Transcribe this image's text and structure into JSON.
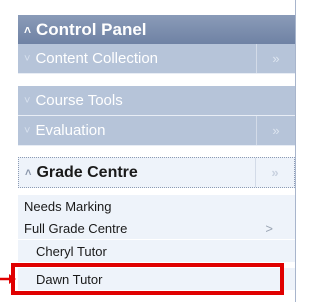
{
  "panel": {
    "title": "Control Panel",
    "sections": [
      {
        "label": "Content Collection"
      },
      {
        "label": "Course Tools"
      },
      {
        "label": "Evaluation"
      },
      {
        "label": "Grade Centre"
      }
    ],
    "grade_centre_items": [
      {
        "label": "Needs Marking"
      },
      {
        "label": "Full Grade Centre",
        "arrow": ">"
      }
    ],
    "full_grade_centre_items": [
      {
        "label": "Cheryl Tutor"
      },
      {
        "label": "Dawn Tutor"
      }
    ]
  },
  "colors": {
    "highlight": "#e00000",
    "header": "#7587a8",
    "section": "#b6c4d9"
  },
  "icons": {
    "collapsed": "chevron-down-icon",
    "expanded": "chevron-up-icon",
    "expand_arrow": "double-chevron-right-icon"
  }
}
